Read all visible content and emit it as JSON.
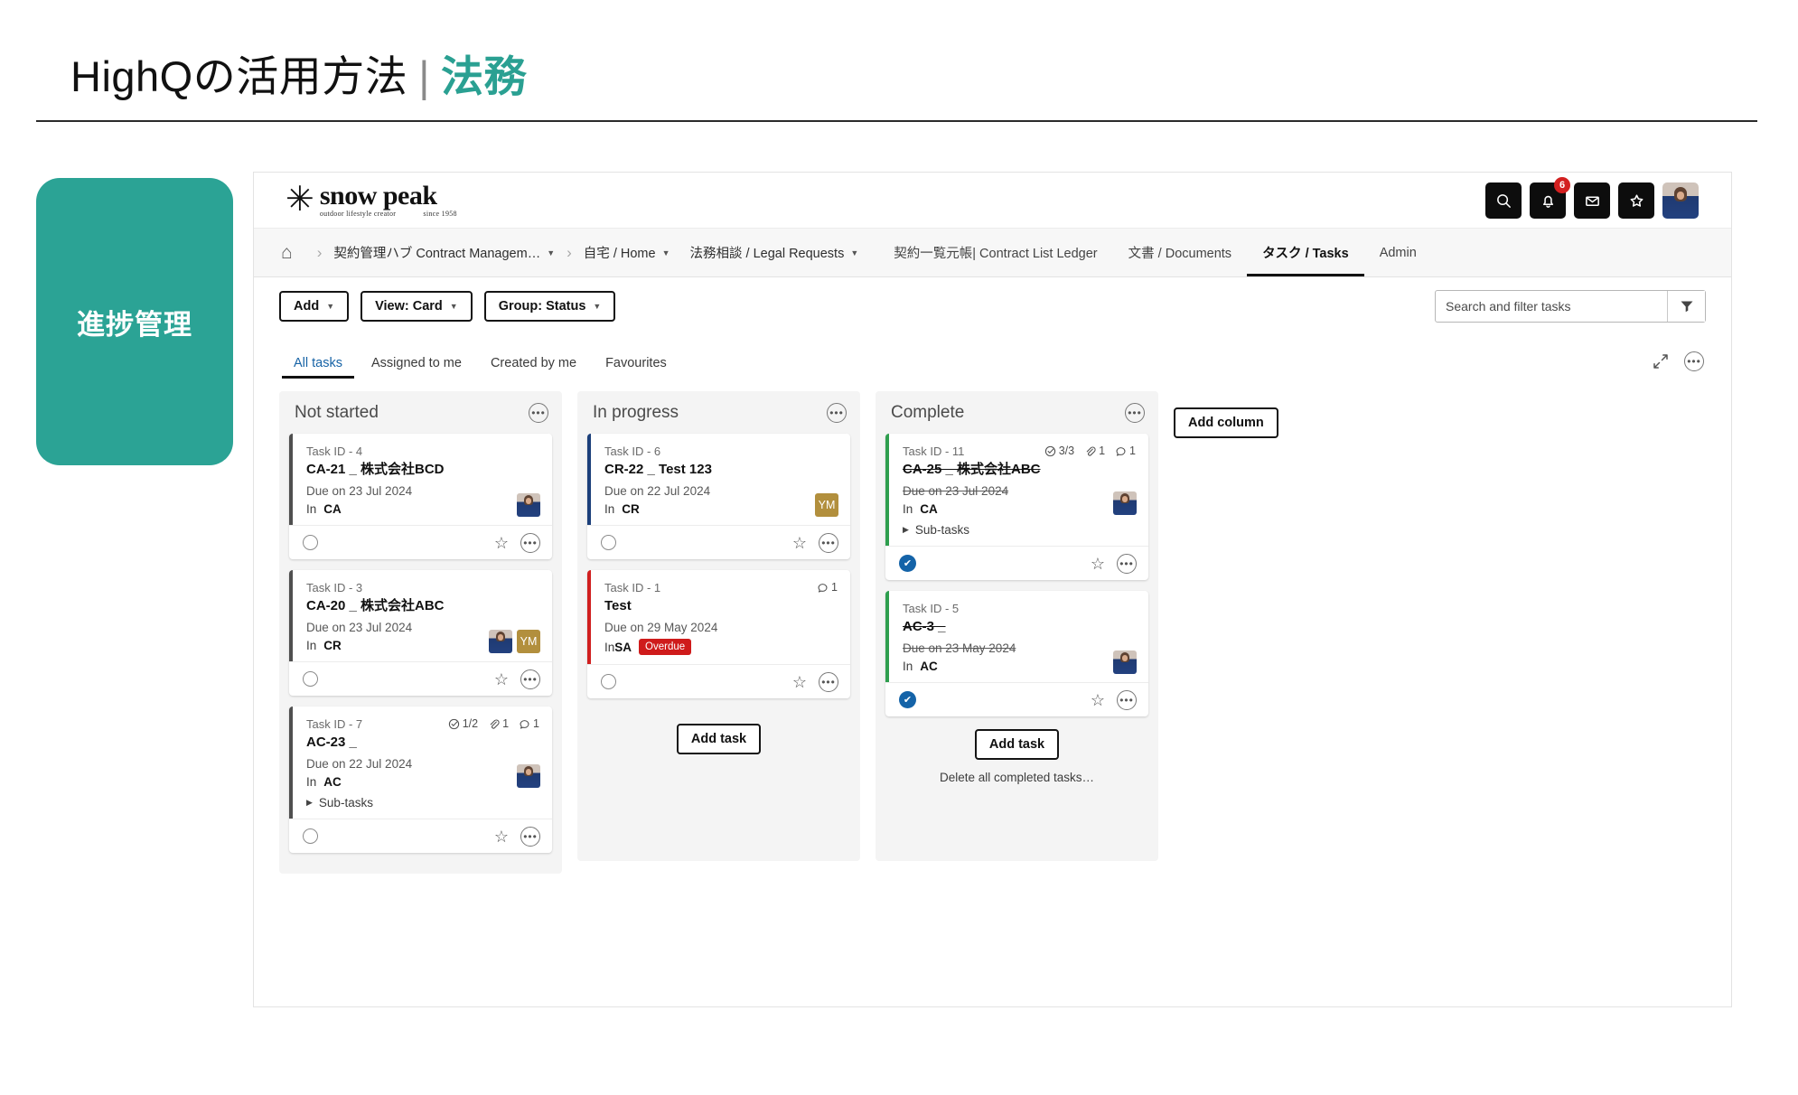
{
  "slide": {
    "title_main": "HighQの活用方法",
    "title_sep": "|",
    "title_accent": "法務",
    "side_panel_label": "進捗管理",
    "accent_color": "#2ba395"
  },
  "app": {
    "logo": {
      "mark": "✳",
      "name": "snow peak",
      "tagline": "outdoor lifestyle creator",
      "since": "since 1958"
    },
    "topbar_actions": [
      {
        "name": "search-icon",
        "badge": ""
      },
      {
        "name": "bell-icon",
        "badge": "6"
      },
      {
        "name": "mail-icon",
        "badge": ""
      },
      {
        "name": "star-icon",
        "badge": ""
      }
    ],
    "breadcrumb": {
      "home_icon": "⌂",
      "items": [
        {
          "label": "契約管理ハブ Contract Managem…",
          "caret": true
        },
        {
          "label": "自宅 / Home",
          "caret": true
        },
        {
          "label": "法務相談 / Legal Requests",
          "caret": true
        }
      ]
    },
    "nav_items": [
      {
        "label": "契約一覧元帳| Contract List Ledger",
        "active": false
      },
      {
        "label": "文書 / Documents",
        "active": false
      },
      {
        "label": "タスク / Tasks",
        "active": true
      },
      {
        "label": "Admin",
        "active": false
      }
    ],
    "toolbar": {
      "add_label": "Add",
      "view_label": "View: Card",
      "group_label": "Group: Status",
      "search_placeholder": "Search and filter tasks",
      "search_value": "",
      "filter_icon": "filter-icon"
    },
    "tabs": [
      {
        "label": "All tasks",
        "active": true
      },
      {
        "label": "Assigned to me",
        "active": false
      },
      {
        "label": "Created by me",
        "active": false
      },
      {
        "label": "Favourites",
        "active": false
      }
    ],
    "add_column_label": "Add column",
    "columns": [
      {
        "title": "Not started",
        "add_task_label": "",
        "delete_all_label": "",
        "cards": [
          {
            "task_id": "Task ID - 4",
            "title": "CA-21 _ 株式会社BCD",
            "due": "Due on 23 Jul 2024",
            "in_prefix": "In",
            "in_code": "CA",
            "overdue": "",
            "subtasks_label": "",
            "checks": "",
            "attachments": "",
            "comments": "",
            "border": "gray",
            "completed": false,
            "struck": false,
            "assignees": [
              {
                "type": "photo",
                "initials": ""
              }
            ]
          },
          {
            "task_id": "Task ID - 3",
            "title": "CA-20 _ 株式会社ABC",
            "due": "Due on 23 Jul 2024",
            "in_prefix": "In",
            "in_code": "CR",
            "overdue": "",
            "subtasks_label": "",
            "checks": "",
            "attachments": "",
            "comments": "",
            "border": "gray",
            "completed": false,
            "struck": false,
            "assignees": [
              {
                "type": "photo",
                "initials": ""
              },
              {
                "type": "initials",
                "initials": "YM"
              }
            ]
          },
          {
            "task_id": "Task ID - 7",
            "title": "AC-23 _",
            "due": "Due on 22 Jul 2024",
            "in_prefix": "In",
            "in_code": "AC",
            "overdue": "",
            "subtasks_label": "Sub-tasks",
            "checks": "1/2",
            "attachments": "1",
            "comments": "1",
            "border": "gray",
            "completed": false,
            "struck": false,
            "assignees": [
              {
                "type": "photo",
                "initials": ""
              }
            ]
          }
        ]
      },
      {
        "title": "In progress",
        "add_task_label": "Add task",
        "delete_all_label": "",
        "cards": [
          {
            "task_id": "Task ID - 6",
            "title": "CR-22 _ Test 123",
            "due": "Due on 22 Jul 2024",
            "in_prefix": "In",
            "in_code": "CR",
            "overdue": "",
            "subtasks_label": "",
            "checks": "",
            "attachments": "",
            "comments": "",
            "border": "blue",
            "completed": false,
            "struck": false,
            "assignees": [
              {
                "type": "initials",
                "initials": "YM"
              }
            ]
          },
          {
            "task_id": "Task ID - 1",
            "title": "Test",
            "due": "Due on 29 May 2024",
            "in_prefix": "In",
            "in_code": "SA",
            "overdue": "Overdue",
            "subtasks_label": "",
            "checks": "",
            "attachments": "",
            "comments": "1",
            "border": "red",
            "completed": false,
            "struck": false,
            "assignees": []
          }
        ]
      },
      {
        "title": "Complete",
        "add_task_label": "Add task",
        "delete_all_label": "Delete all completed tasks…",
        "cards": [
          {
            "task_id": "Task ID - 11",
            "title": "CA-25 _ 株式会社ABC",
            "due": "Due on 23 Jul 2024",
            "in_prefix": "In",
            "in_code": "CA",
            "overdue": "",
            "subtasks_label": "Sub-tasks",
            "checks": "3/3",
            "attachments": "1",
            "comments": "1",
            "border": "green",
            "completed": true,
            "struck": true,
            "assignees": [
              {
                "type": "photo",
                "initials": ""
              }
            ]
          },
          {
            "task_id": "Task ID - 5",
            "title": "AC-3 _",
            "due": "Due on 23 May 2024",
            "in_prefix": "In",
            "in_code": "AC",
            "overdue": "",
            "subtasks_label": "",
            "checks": "",
            "attachments": "",
            "comments": "",
            "border": "green",
            "completed": true,
            "struck": true,
            "assignees": [
              {
                "type": "photo",
                "initials": ""
              }
            ]
          }
        ]
      }
    ]
  }
}
